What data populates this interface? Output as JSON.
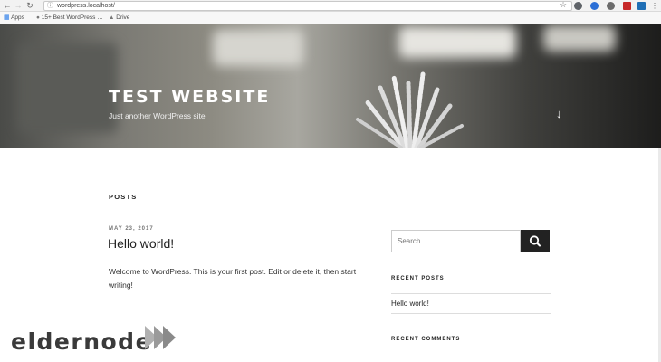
{
  "browser": {
    "address_url": "wordpress.localhost/",
    "bookmarks": [
      "Apps",
      "15+ Best WordPress …",
      "Drive"
    ],
    "extension_colors": [
      "#5f6368",
      "#2b6fd6",
      "#6b6b6b",
      "#c62828",
      "#1f6fb5"
    ]
  },
  "site": {
    "title": "TEST WEBSITE",
    "description": "Just another WordPress site"
  },
  "posts_section": {
    "heading": "POSTS",
    "post": {
      "date": "MAY 23, 2017",
      "title": "Hello world!",
      "excerpt": "Welcome to WordPress. This is your first post. Edit or delete it, then start writing!"
    }
  },
  "sidebar": {
    "search_placeholder": "Search …",
    "recent_posts_heading": "RECENT POSTS",
    "recent_posts": [
      "Hello world!"
    ],
    "recent_comments_heading": "RECENT COMMENTS"
  },
  "watermark": {
    "brand": "eldernode"
  },
  "colors": {
    "search_button": "#222222",
    "logo_text": "#3a3a3a",
    "logo_arrows": "#8a8a8a"
  }
}
